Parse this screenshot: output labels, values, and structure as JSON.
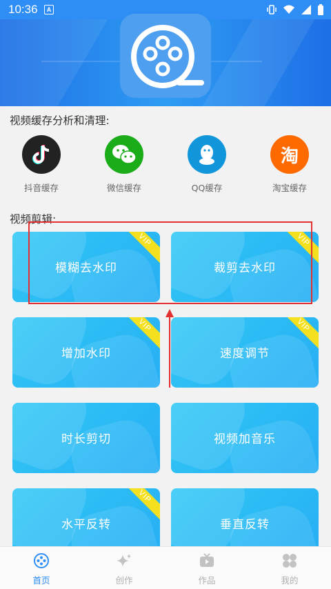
{
  "status_bar": {
    "time": "10:36"
  },
  "section_cache": {
    "title": "视频缓存分析和清理:"
  },
  "cache_items": [
    {
      "label": "抖音缓存",
      "icon": "tiktok-icon",
      "color": "#222222"
    },
    {
      "label": "微信缓存",
      "icon": "wechat-icon",
      "color": "#1aad19"
    },
    {
      "label": "QQ缓存",
      "icon": "qq-icon",
      "color": "#1296db"
    },
    {
      "label": "淘宝缓存",
      "icon": "taobao-icon",
      "glyph": "淘",
      "color": "#ff6a00"
    }
  ],
  "section_edit": {
    "title": "视频剪辑:"
  },
  "edit_cards": [
    {
      "label": "模糊去水印",
      "vip": "VIP"
    },
    {
      "label": "裁剪去水印",
      "vip": "VIP"
    },
    {
      "label": "增加水印",
      "vip": "VIP"
    },
    {
      "label": "速度调节",
      "vip": "VIP"
    },
    {
      "label": "时长剪切",
      "vip": ""
    },
    {
      "label": "视频加音乐",
      "vip": ""
    },
    {
      "label": "水平反转",
      "vip": "VIP"
    },
    {
      "label": "垂直反转",
      "vip": ""
    }
  ],
  "tabs": [
    {
      "label": "首页",
      "icon": "film-reel-icon",
      "active": true
    },
    {
      "label": "创作",
      "icon": "sparkle-icon",
      "active": false
    },
    {
      "label": "作品",
      "icon": "tv-icon",
      "active": false
    },
    {
      "label": "我的",
      "icon": "clover-icon",
      "active": false
    }
  ],
  "colors": {
    "primary": "#2f8ef5",
    "card": "#2bbaf5",
    "vip_ribbon": "#f5e020",
    "annotation": "#e23030",
    "tab_active": "#2f8ef5",
    "tab_inactive": "#b0b0b0"
  }
}
